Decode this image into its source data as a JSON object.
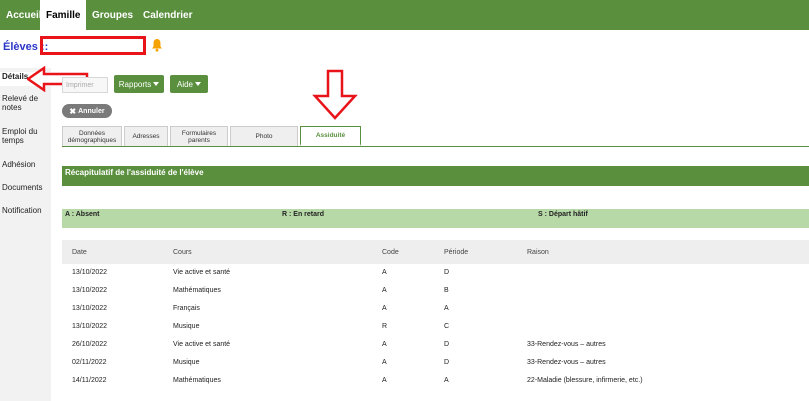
{
  "topnav": {
    "tabs": [
      "Accueil",
      "Famille",
      "Groupes",
      "Calendrier"
    ],
    "active": "Famille"
  },
  "page": {
    "title": "Élèves ::"
  },
  "sidebar": {
    "items": [
      "Détails",
      "Relevé de notes",
      "Emploi du temps",
      "Adhésion",
      "Documents",
      "Notification"
    ]
  },
  "toolbar": {
    "ghost_label": "Imprimer",
    "rapports_label": "Rapports",
    "aide_label": "Aide",
    "annuler_label": "Annuler"
  },
  "tabs": [
    "Données démographiques",
    "Adresses",
    "Formulaires parents",
    "Photo",
    "Assiduité"
  ],
  "active_tab": "Assiduité",
  "section": {
    "title": "Récapitulatif de l'assiduité de l'élève"
  },
  "legend": {
    "absent": "A : Absent",
    "late": "R : En retard",
    "early": "S : Départ hâtif"
  },
  "table": {
    "headers": {
      "date": "Date",
      "cours": "Cours",
      "code": "Code",
      "periode": "Période",
      "raison": "Raison"
    },
    "rows": [
      {
        "date": "13/10/2022",
        "cours": "Vie active et santé",
        "code": "A",
        "periode": "D",
        "raison": ""
      },
      {
        "date": "13/10/2022",
        "cours": "Mathématiques",
        "code": "A",
        "periode": "B",
        "raison": ""
      },
      {
        "date": "13/10/2022",
        "cours": "Français",
        "code": "A",
        "periode": "A",
        "raison": ""
      },
      {
        "date": "13/10/2022",
        "cours": "Musique",
        "code": "R",
        "periode": "C",
        "raison": ""
      },
      {
        "date": "26/10/2022",
        "cours": "Vie active et santé",
        "code": "A",
        "periode": "D",
        "raison": "33-Rendez-vous – autres"
      },
      {
        "date": "02/11/2022",
        "cours": "Musique",
        "code": "A",
        "periode": "D",
        "raison": "33-Rendez-vous – autres"
      },
      {
        "date": "14/11/2022",
        "cours": "Mathématiques",
        "code": "A",
        "periode": "A",
        "raison": "22-Maladie (blessure, infirmerie, etc.)"
      }
    ]
  },
  "colors": {
    "brand_green": "#5a8f3e",
    "legend_green": "#b7d9a8",
    "title_blue": "#2a35c8",
    "annotation_red": "#e8141a",
    "bell_orange": "#f5a300"
  },
  "icons": {
    "bell": "bell-icon",
    "caret": "caret-down-icon",
    "cancel": "x-icon",
    "arrow_left": "red-arrow-left-icon",
    "arrow_down": "red-arrow-down-icon"
  }
}
